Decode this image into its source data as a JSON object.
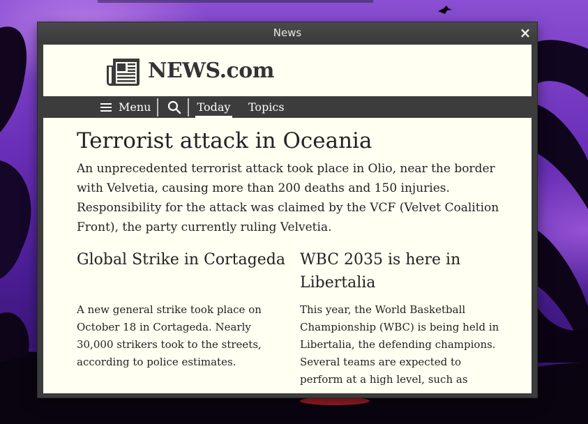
{
  "window": {
    "title": "News",
    "close_label": "×"
  },
  "site": {
    "logo_text": "NEWS.com"
  },
  "nav": {
    "menu_label": "Menu",
    "tabs": [
      {
        "label": "Today",
        "active": true
      },
      {
        "label": "Topics",
        "active": false
      }
    ]
  },
  "main_article": {
    "headline": "Terrorist attack in Oceania",
    "lead": "An unprecedented terrorist attack took place in Olio, near the border with Velvetia, causing more than 200 deaths and 150 injuries. Responsibility for the attack was claimed by the VCF (Velvet Coalition Front), the party currently ruling Velvetia."
  },
  "articles": [
    {
      "title": "Global Strike in Cortageda",
      "body": "A new general strike took place on October 18 in Cortageda. Nearly 30,000 strikers took to the streets, according to police estimates."
    },
    {
      "title": "WBC 2035 is here in Libertalia",
      "body": "This year, the World Basketball Championship (WBC) is being held in Libertalia, the defending champions. Several teams are expected to perform at a high level, such as"
    }
  ],
  "colors": {
    "window_chrome": "#3c3c3c",
    "page_background": "#fffff2",
    "text": "#222222",
    "nav_text": "#ffffff"
  },
  "icons": [
    "newspaper-icon",
    "hamburger-icon",
    "search-icon",
    "close-icon"
  ]
}
